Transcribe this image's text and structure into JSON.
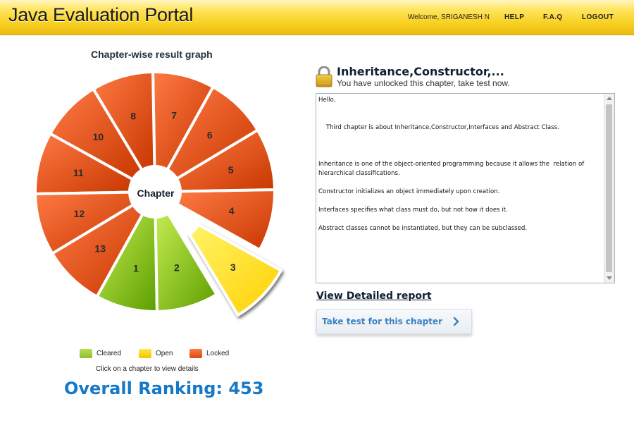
{
  "header": {
    "logo": "Java Evaluation Portal",
    "welcome": "Welcome, SRIGANESH N",
    "nav": [
      "HELP",
      "F.A.Q",
      "LOGOUT"
    ]
  },
  "graph": {
    "title": "Chapter-wise result graph",
    "center_label": "Chapter",
    "chapters": [
      {
        "n": "1",
        "status": "cleared"
      },
      {
        "n": "2",
        "status": "cleared"
      },
      {
        "n": "3",
        "status": "open"
      },
      {
        "n": "4",
        "status": "locked"
      },
      {
        "n": "5",
        "status": "locked"
      },
      {
        "n": "6",
        "status": "locked"
      },
      {
        "n": "7",
        "status": "locked"
      },
      {
        "n": "8",
        "status": "locked"
      },
      {
        "n": "10",
        "status": "locked"
      },
      {
        "n": "11",
        "status": "locked"
      },
      {
        "n": "12",
        "status": "locked"
      },
      {
        "n": "13",
        "status": "locked"
      }
    ],
    "colors": {
      "cleared": [
        "#c4ec50",
        "#5c9e00"
      ],
      "open": [
        "#fff46a",
        "#ffd000"
      ],
      "locked": [
        "#ff7a44",
        "#c83700"
      ]
    }
  },
  "legend": {
    "cleared": "Cleared",
    "open": "Open",
    "locked": "Locked",
    "hint": "Click on a chapter to view details"
  },
  "ranking": {
    "label": "Overall Ranking:",
    "value": "453"
  },
  "chapter_panel": {
    "title": "Inheritance,Constructor,...",
    "subtitle": "You have unlocked this chapter, take test now.",
    "description": "Hello,\n\n\n    Third chapter is about Inheritance,Constructor,Interfaces and Abstract Class.\n\n\n\nInheritance is one of the object-oriented programming because it allows the  relation of hierarchical classifications.\n\nConstructor initializes an object immediately upon creation.\n\nInterfaces specifies what class must do, but not how it does it.\n\nAbstract classes cannot be instantiated, but they can be subclassed.",
    "report_link": "View Detailed report",
    "take_test_button": "Take test for this chapter"
  }
}
